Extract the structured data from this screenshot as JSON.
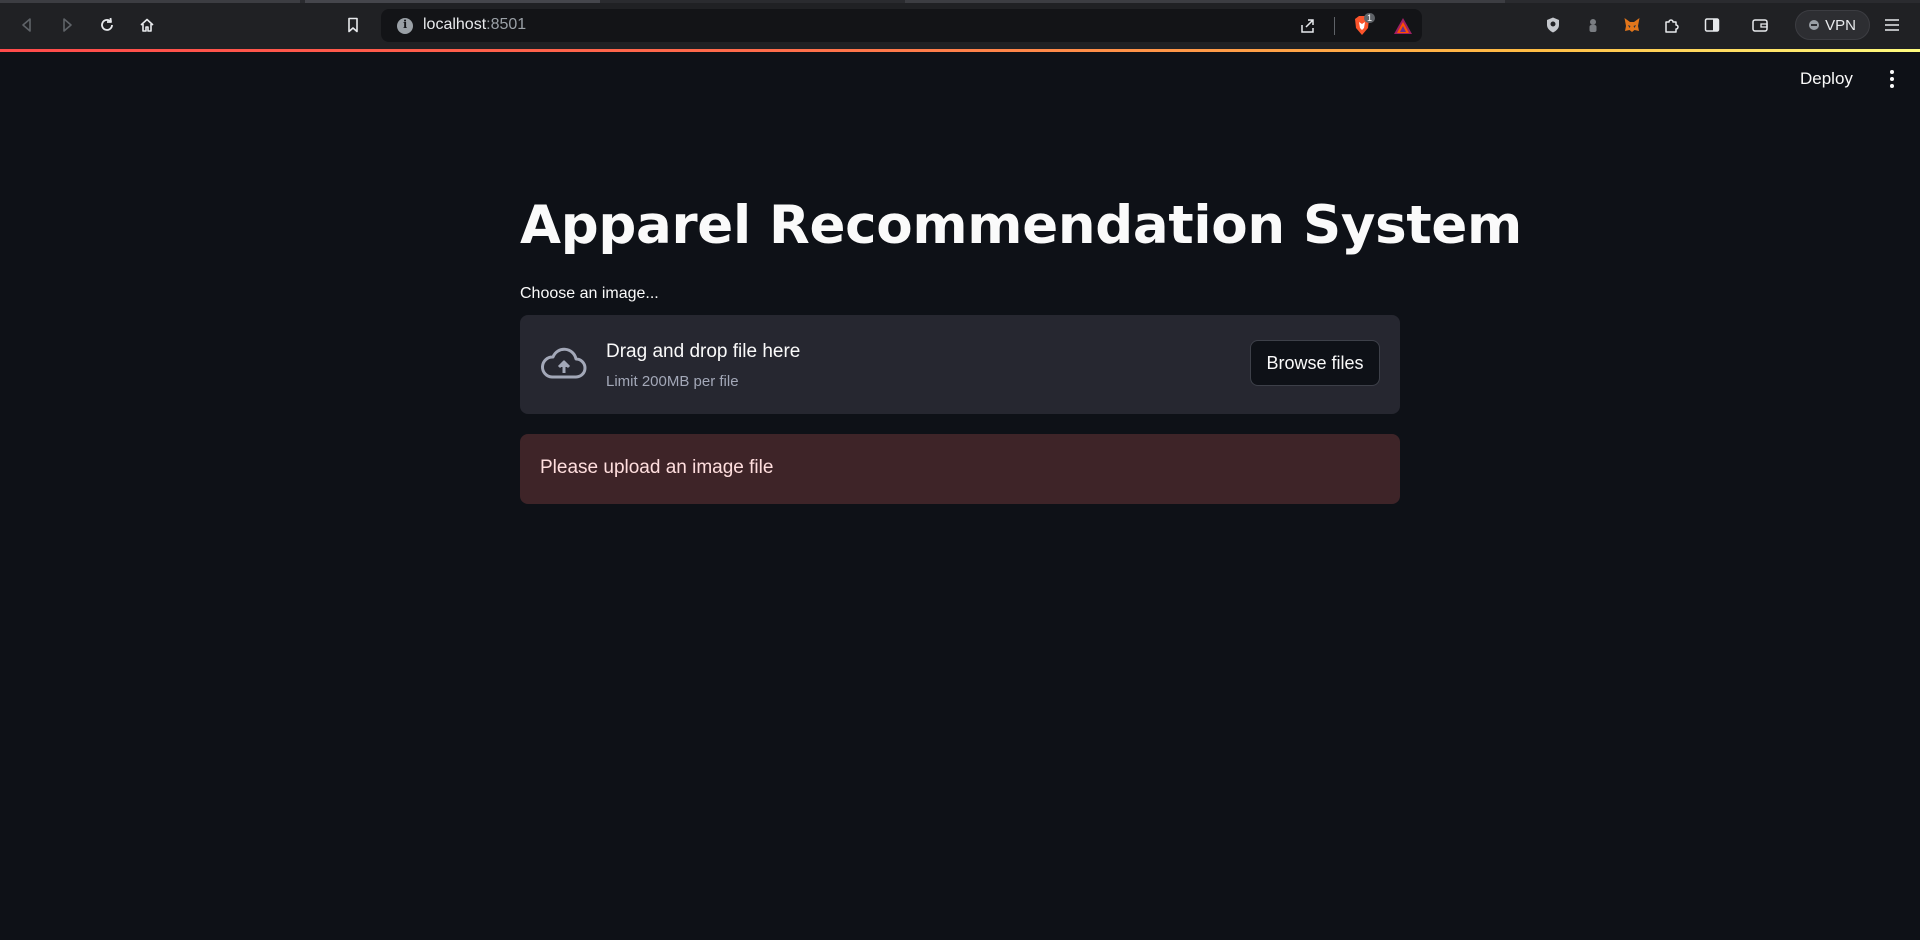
{
  "browser": {
    "url_host": "localhost",
    "url_port": ":8501",
    "vpn_label": "VPN",
    "shields_count": "1",
    "icons": [
      "back-icon",
      "forward-icon",
      "reload-icon",
      "home-icon",
      "bookmark-icon",
      "share-icon",
      "brave-shields-icon",
      "rewards-icon",
      "extension-icon",
      "metamask-icon",
      "puzzle-icon",
      "sidebar-icon",
      "wallet-icon",
      "menu-icon"
    ]
  },
  "app": {
    "deploy_label": "Deploy",
    "title": "Apparel Recommendation System",
    "uploader_label": "Choose an image...",
    "dropzone_title": "Drag and drop file here",
    "dropzone_limit": "Limit 200MB per file",
    "browse_label": "Browse files",
    "alert_text": "Please upload an image file"
  },
  "colors": {
    "background": "#0e1117",
    "dropzone": "#262730",
    "alert_background": "#3e2428",
    "alert_text": "#ffdede",
    "accent": "#ff4b4b"
  }
}
